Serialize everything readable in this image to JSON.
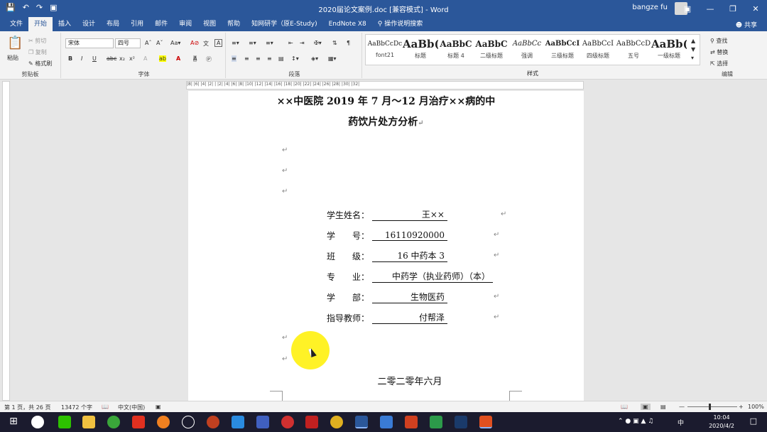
{
  "titlebar": {
    "title": "2020届论文案例.doc [兼容模式] - Word",
    "user": "bangze fu",
    "qat_save": "save-icon",
    "qat_undo": "undo-icon",
    "qat_redo": "redo-icon",
    "qat_preview": "print-preview-icon"
  },
  "tabs": [
    {
      "label": "文件"
    },
    {
      "label": "开始"
    },
    {
      "label": "插入"
    },
    {
      "label": "设计"
    },
    {
      "label": "布局"
    },
    {
      "label": "引用"
    },
    {
      "label": "邮件"
    },
    {
      "label": "审阅"
    },
    {
      "label": "视图"
    },
    {
      "label": "帮助"
    },
    {
      "label": "知网研学（原E-Study)"
    },
    {
      "label": "EndNote X8"
    },
    {
      "label": "操作说明搜索"
    }
  ],
  "share": "共享",
  "clipboard": {
    "paste": "粘贴",
    "cut": "剪切",
    "copy": "复制",
    "painter": "格式刷",
    "label": "剪贴板"
  },
  "font": {
    "name": "宋体",
    "size": "四号",
    "label": "字体"
  },
  "paragraph": {
    "label": "段落"
  },
  "styles": {
    "label": "样式",
    "items": [
      {
        "preview": "AaBbCcDc",
        "name": "font21"
      },
      {
        "preview": "AaBb(",
        "name": "标题"
      },
      {
        "preview": "AaBbC",
        "name": "标题 4"
      },
      {
        "preview": "AaBbC",
        "name": "二级标题"
      },
      {
        "preview": "AaBbCc",
        "name": "强调"
      },
      {
        "preview": "AaBbCcI",
        "name": "三级标题"
      },
      {
        "preview": "AaBbCcI",
        "name": "四级标题"
      },
      {
        "preview": "AaBbCcD",
        "name": "五号"
      },
      {
        "preview": "AaBb(",
        "name": "一级标题"
      }
    ]
  },
  "editing": {
    "find": "查找",
    "replace": "替换",
    "select": "选择",
    "label": "编辑"
  },
  "ruler": "|8| |6| |4| |2| | |2| |4| |6| |8| |10| |12| |14| |16| |18| |20| |22| |24| |26| |28| |30| |32|",
  "doc": {
    "title_line1": "××中医院 2019 年 7 月～12 月治疗××病的中",
    "title_line2": "药饮片处方分析",
    "para_mark": "↵",
    "fields": [
      {
        "label": "学生姓名：",
        "value": "王××"
      },
      {
        "label": "学　　号：",
        "value": "16110920000"
      },
      {
        "label": "班　　级：",
        "value": "16 中药本 3"
      },
      {
        "label": "专　　业：",
        "value": "中药学（执业药师）（本）"
      },
      {
        "label": "学　　部：",
        "value": "生物医药"
      },
      {
        "label": "指导教师：",
        "value": "付帮泽"
      }
    ],
    "date": "二零二零年六月"
  },
  "status": {
    "page": "第 1 页，共 26 页",
    "words": "13472 个字",
    "lang": "中文(中国)",
    "zoom": "100%"
  },
  "taskbar": {
    "time": "10:04",
    "date": "2020/4/2",
    "ime": "中"
  }
}
